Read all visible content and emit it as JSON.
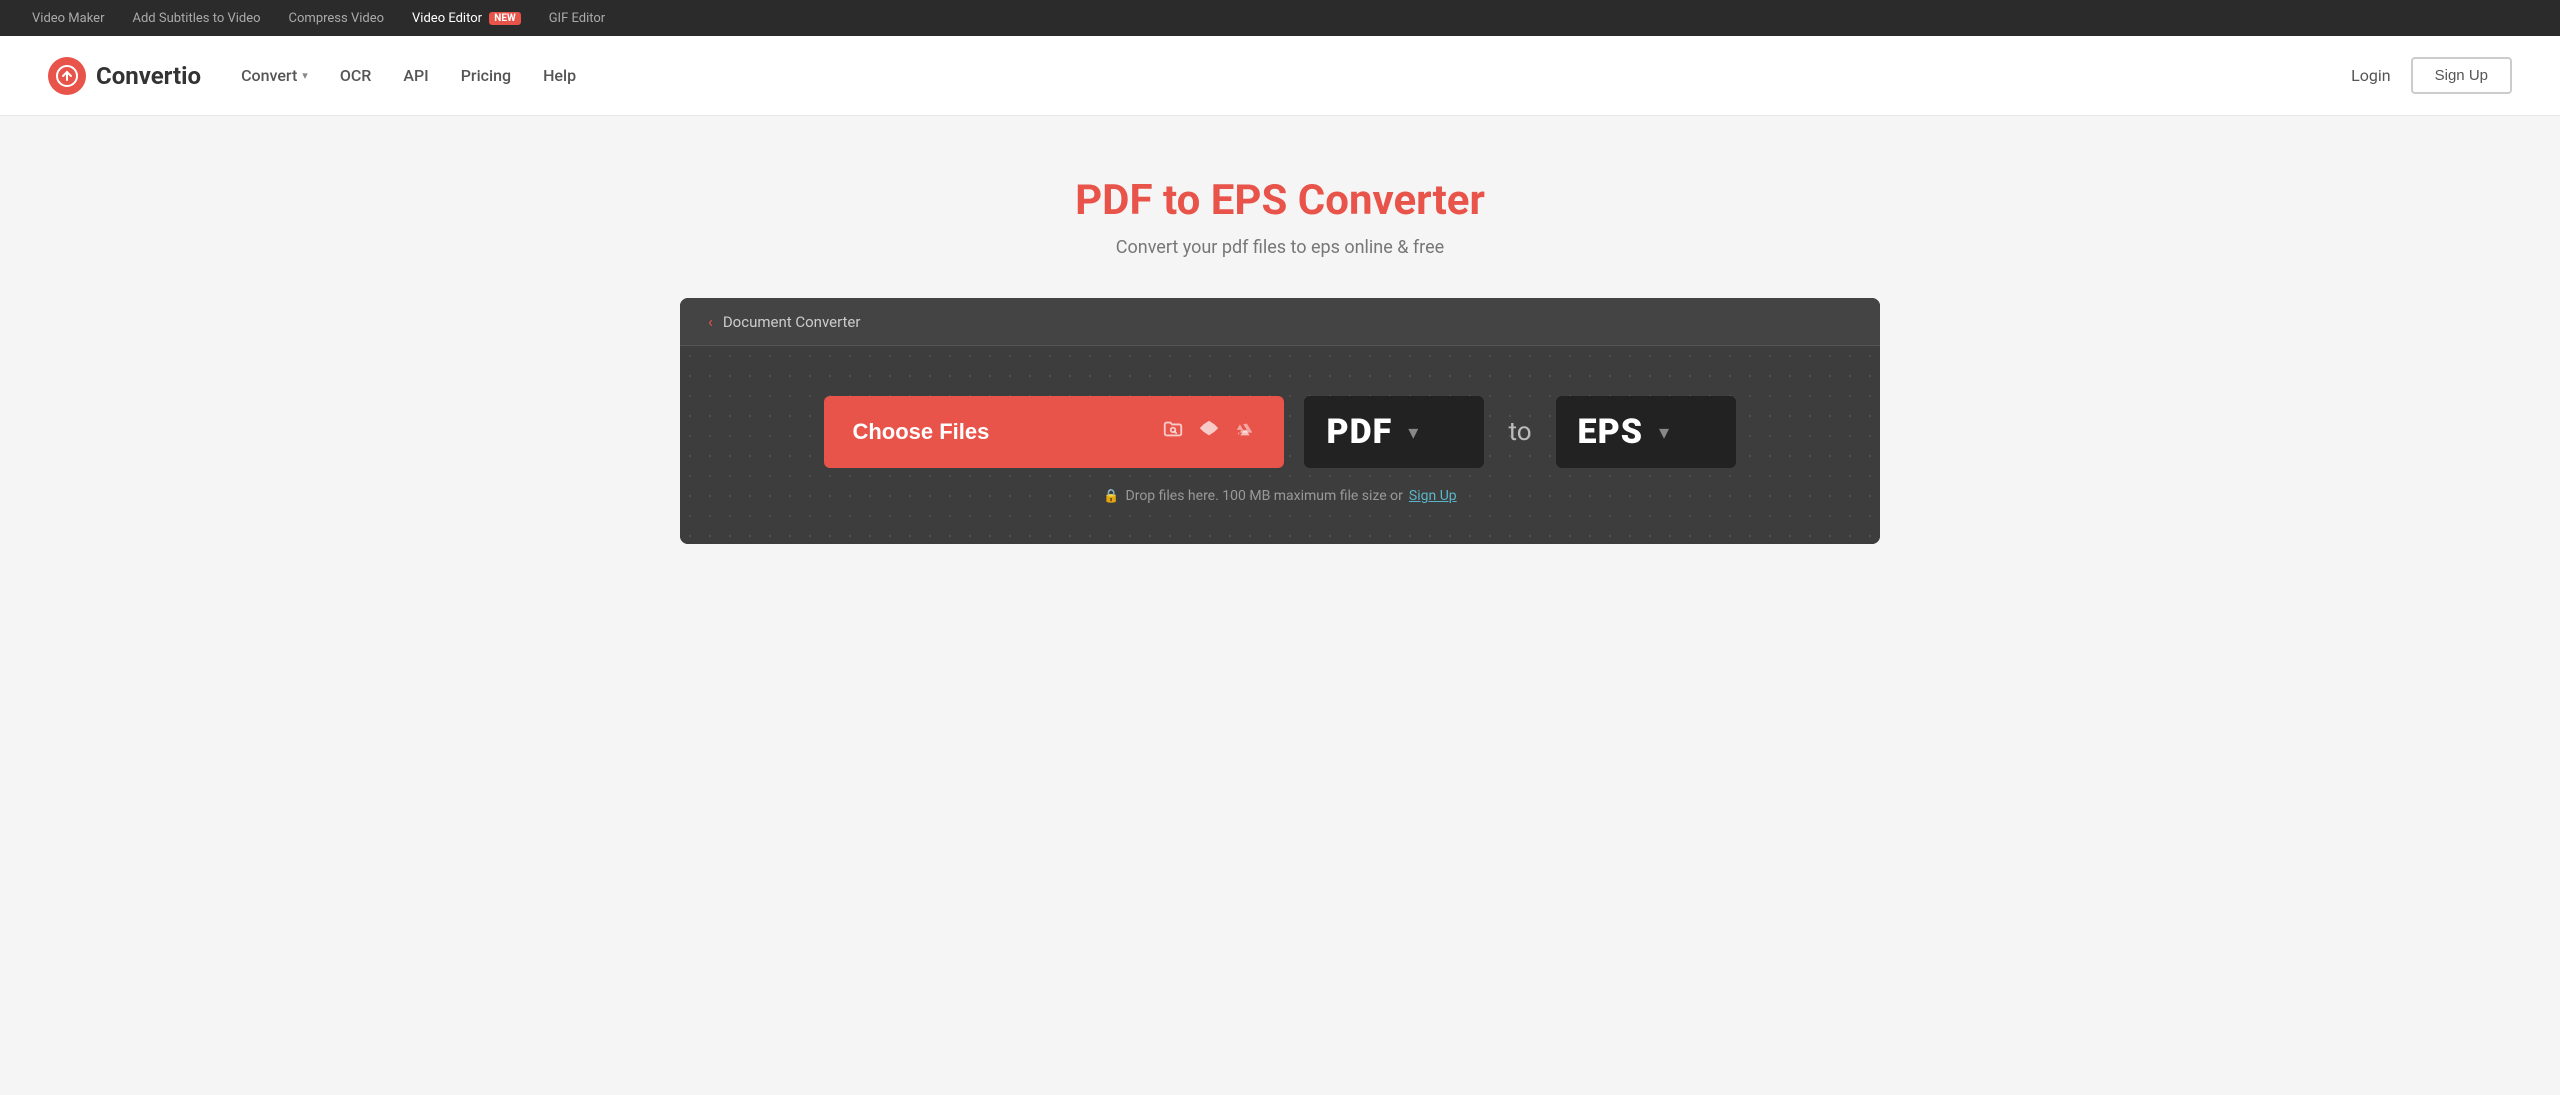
{
  "topbar": {
    "links": [
      {
        "label": "Video Maker",
        "active": false
      },
      {
        "label": "Add Subtitles to Video",
        "active": false
      },
      {
        "label": "Compress Video",
        "active": false
      },
      {
        "label": "Video Editor",
        "active": true,
        "badge": "NEW"
      },
      {
        "label": "GIF Editor",
        "active": false
      }
    ]
  },
  "navbar": {
    "logo_text": "Convertio",
    "nav_links": [
      {
        "label": "Convert",
        "has_chevron": true
      },
      {
        "label": "OCR",
        "has_chevron": false
      },
      {
        "label": "API",
        "has_chevron": false
      },
      {
        "label": "Pricing",
        "has_chevron": false
      },
      {
        "label": "Help",
        "has_chevron": false
      }
    ],
    "login_label": "Login",
    "signup_label": "Sign Up"
  },
  "hero": {
    "title": "PDF to EPS Converter",
    "subtitle": "Convert your pdf files to eps online & free"
  },
  "converter": {
    "header_label": "Document Converter",
    "choose_files_label": "Choose Files",
    "from_format": "PDF",
    "to_label": "to",
    "to_format": "EPS",
    "drop_info": "Drop files here. 100 MB maximum file size or",
    "signup_link_label": "Sign Up"
  }
}
